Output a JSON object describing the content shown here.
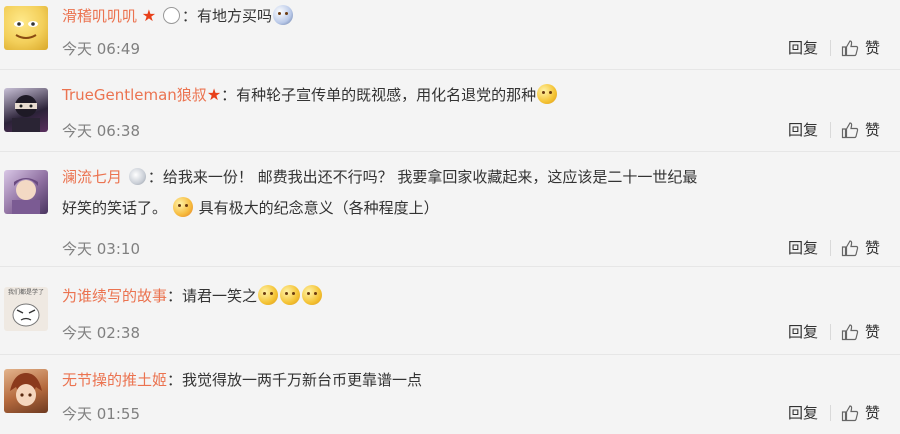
{
  "comments": [
    {
      "user": "滑稽叽叽叽",
      "sep": "：",
      "text": "有地方买吗",
      "time": "今天 06:49",
      "reply_label": "回复",
      "like_label": "赞",
      "avatar_color": "#f3cf5a"
    },
    {
      "user": "TrueGentleman狼叔",
      "sep": "：",
      "text": "有种轮子宣传单的既视感，用化名退党的那种",
      "time": "今天 06:38",
      "reply_label": "回复",
      "like_label": "赞",
      "avatar_color": "#2b2238"
    },
    {
      "user": "澜流七月",
      "sep": "：",
      "text_line1": "给我来一份！ 邮费我出还不行吗？  我要拿回家收藏起来，这应该是二十一世纪最",
      "text_line2a": "好笑的笑话了。",
      "text_line2b": "具有极大的纪念意义（各种程度上）",
      "time": "今天 03:10",
      "reply_label": "回复",
      "like_label": "赞",
      "avatar_color": "#8e6fa0"
    },
    {
      "user": "为谁续写的故事",
      "sep": "：",
      "text": "请君一笑之",
      "time": "今天 02:38",
      "reply_label": "回复",
      "like_label": "赞",
      "avatar_color": "#e9e2da",
      "avatar_caption": "我们都是学了"
    },
    {
      "user": "无节操的推土姬",
      "sep": "：",
      "text": "我觉得放一两千万新台币更靠谱一点",
      "time": "今天 01:55",
      "reply_label": "回复",
      "like_label": "赞",
      "avatar_color": "#b56a3e"
    }
  ],
  "icons": {
    "like": "thumbs-up-icon",
    "vip": "star-icon",
    "emoji": "smiley-emoji-icon"
  },
  "colors": {
    "username": "#eb7350",
    "time": "#808080",
    "background": "#f4f4f4"
  }
}
